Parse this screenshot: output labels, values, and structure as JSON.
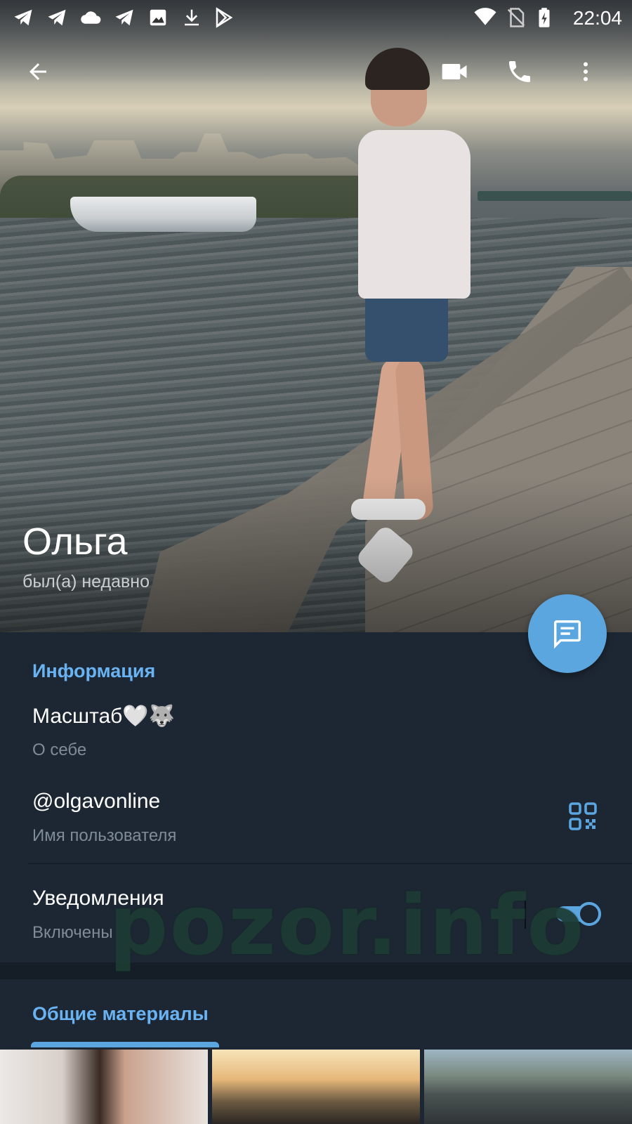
{
  "status_bar": {
    "time": "22:04",
    "left_icons": [
      "telegram-icon",
      "telegram-icon",
      "cloud-icon",
      "telegram-icon",
      "image-icon",
      "download-icon",
      "play-store-icon"
    ],
    "right_icons": [
      "wifi-icon",
      "no-sim-icon",
      "battery-charging-icon"
    ]
  },
  "top_bar": {
    "back_icon": "arrow-left-icon",
    "video_call_icon": "video-camera-icon",
    "call_icon": "phone-icon",
    "menu_icon": "more-vertical-icon"
  },
  "profile": {
    "name": "Ольга",
    "status": "был(а) недавно"
  },
  "fab": {
    "icon": "message-icon",
    "color": "#5ca6e0"
  },
  "info": {
    "section_title": "Информация",
    "bio": {
      "value": "Масштаб🤍🐺",
      "label": "О себе"
    },
    "username": {
      "value": "@olgavonline",
      "label": "Имя пользователя",
      "action_icon": "qr-code-icon"
    },
    "notifications": {
      "value": "Уведомления",
      "label": "Включены",
      "enabled": true
    }
  },
  "shared_media": {
    "title": "Общие материалы",
    "thumbnails": [
      "photo-thumbnail",
      "photo-thumbnail",
      "photo-thumbnail"
    ]
  },
  "watermark": "pozor.info",
  "colors": {
    "accent": "#5ca6e0",
    "section_title": "#6ab3f3",
    "background": "#1d2733",
    "secondary_text": "#7f8b97"
  }
}
